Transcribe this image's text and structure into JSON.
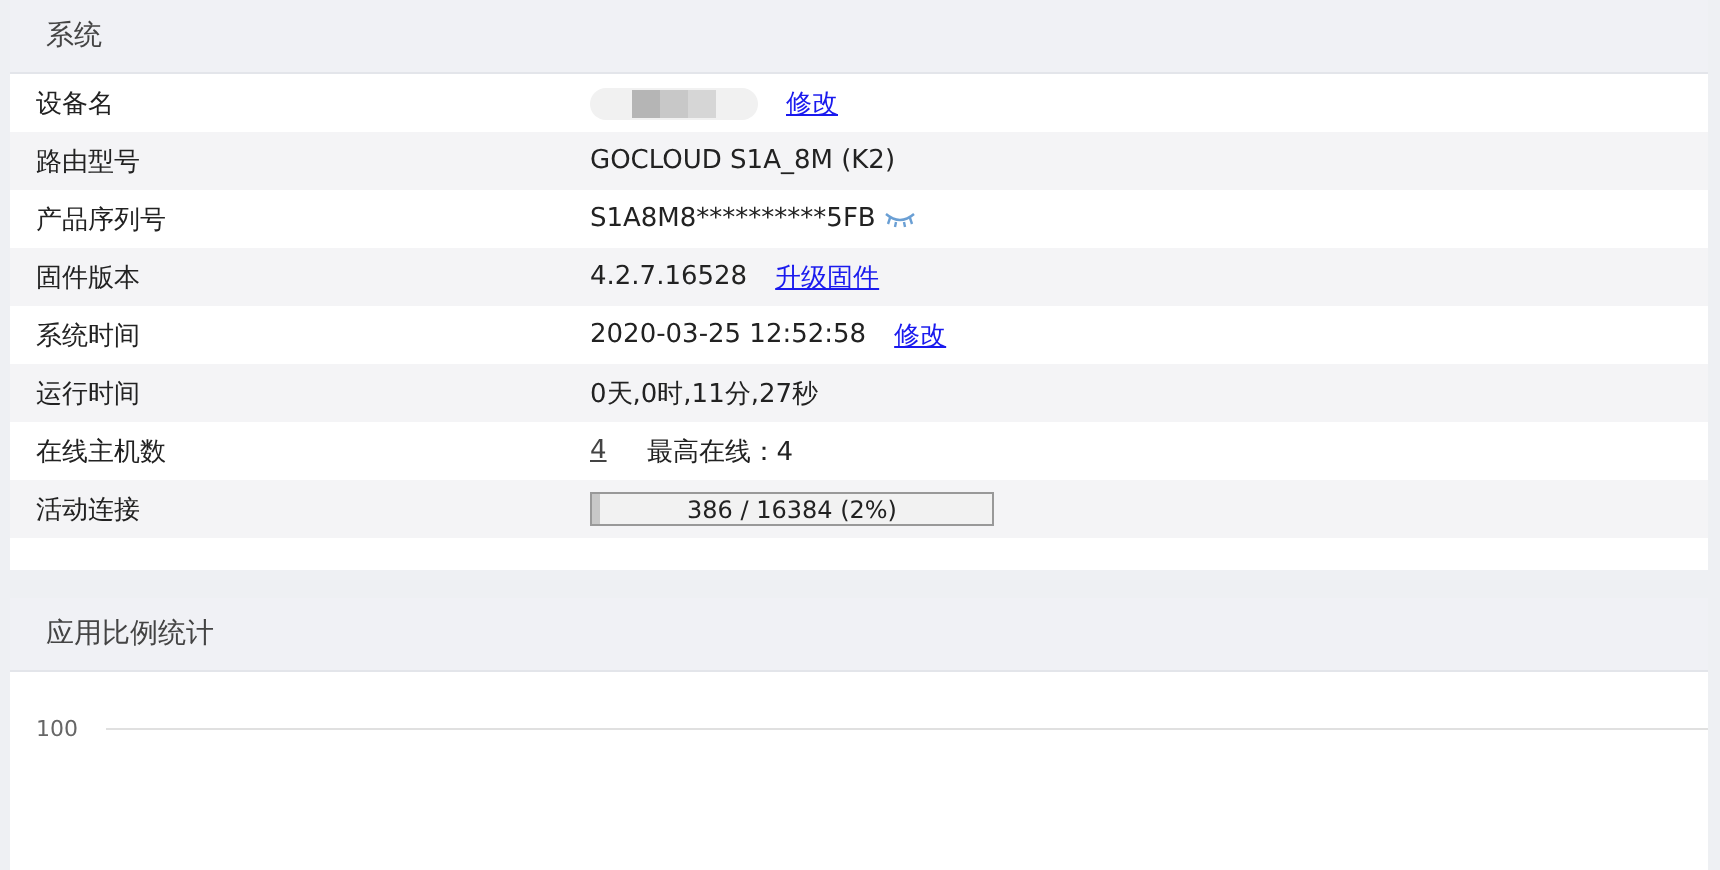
{
  "system_card": {
    "title": "系统",
    "rows": [
      {
        "label": "设备名",
        "parts": [
          {
            "kind": "redacted"
          },
          {
            "kind": "link",
            "text": "修改"
          }
        ]
      },
      {
        "label": "路由型号",
        "parts": [
          {
            "kind": "text",
            "text": "GOCLOUD S1A_8M (K2)"
          }
        ]
      },
      {
        "label": "产品序列号",
        "parts": [
          {
            "kind": "text",
            "text": "S1A8M8**********5FB"
          },
          {
            "kind": "eye"
          }
        ]
      },
      {
        "label": "固件版本",
        "parts": [
          {
            "kind": "text",
            "text": "4.2.7.16528"
          },
          {
            "kind": "link",
            "text": "升级固件"
          }
        ]
      },
      {
        "label": "系统时间",
        "parts": [
          {
            "kind": "text",
            "text": "2020-03-25 12:52:58"
          },
          {
            "kind": "link",
            "text": "修改"
          }
        ]
      },
      {
        "label": "运行时间",
        "parts": [
          {
            "kind": "text",
            "text": "0天,0时,11分,27秒"
          }
        ]
      },
      {
        "label": "在线主机数",
        "parts": [
          {
            "kind": "count",
            "text": "4"
          },
          {
            "kind": "text",
            "text": "最高在线：4"
          }
        ]
      },
      {
        "label": "活动连接",
        "parts": [
          {
            "kind": "progress",
            "level": 0.02,
            "text": "386 / 16384 (2%)"
          }
        ]
      }
    ]
  },
  "app_card": {
    "title": "应用比例统计",
    "chart": {
      "ytick": "100"
    }
  }
}
